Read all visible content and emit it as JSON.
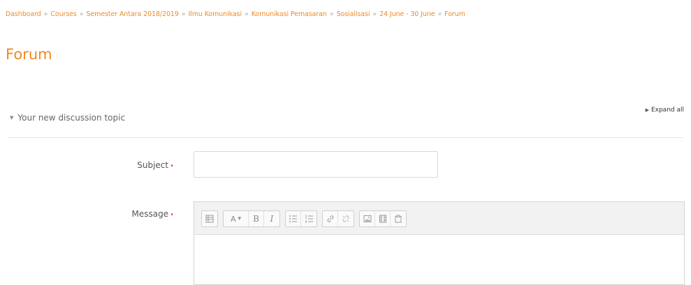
{
  "breadcrumb": {
    "items": [
      "Dashboard",
      "Courses",
      "Semester Antara 2018/2019",
      "Ilmu Komunikasi",
      "Komunikasi Pemasaran",
      "Sosialisasi",
      "24 June - 30 June",
      "Forum"
    ],
    "separator": "»"
  },
  "page": {
    "title": "Forum"
  },
  "form": {
    "expand_all_label": "Expand all",
    "section_title": "Your new discussion topic",
    "subject_label": "Subject",
    "subject_value": "",
    "message_label": "Message",
    "required_marker": "•"
  },
  "editor": {
    "toolbar_icons": [
      "toolbar-toggle-icon",
      "font-style-icon",
      "bold-icon",
      "italic-icon",
      "unordered-list-icon",
      "ordered-list-icon",
      "link-icon",
      "unlink-icon",
      "image-icon",
      "media-icon",
      "manage-files-icon"
    ],
    "bold_glyph": "B",
    "italic_glyph": "I",
    "font_glyph": "A",
    "dropdown_glyph": "▾"
  },
  "colors": {
    "accent": "#f08a24",
    "required": "#e2563a",
    "toolbar_bg": "#f2f2f2"
  }
}
